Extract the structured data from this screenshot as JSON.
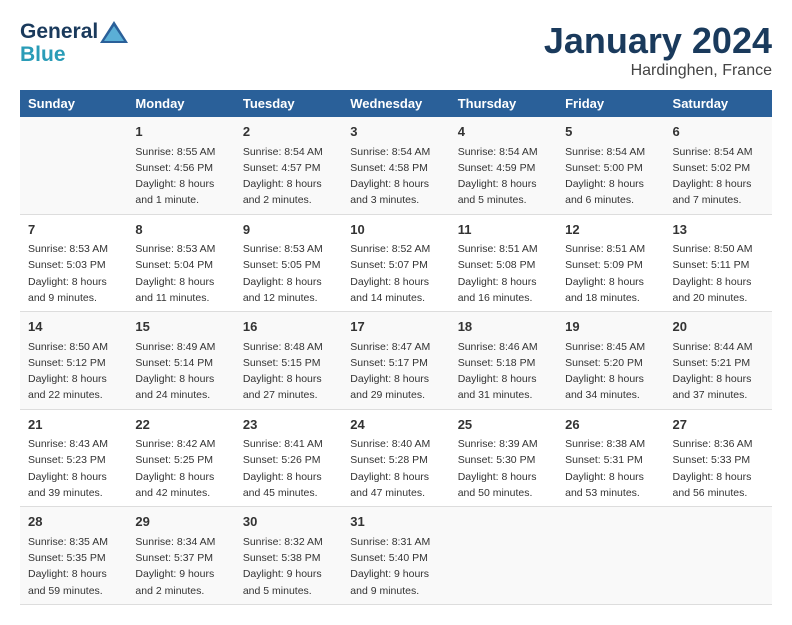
{
  "header": {
    "logo": {
      "line1": "General",
      "line2": "Blue"
    },
    "month": "January 2024",
    "location": "Hardinghen, France"
  },
  "columns": [
    "Sunday",
    "Monday",
    "Tuesday",
    "Wednesday",
    "Thursday",
    "Friday",
    "Saturday"
  ],
  "weeks": [
    [
      {
        "day": "",
        "sunrise": "",
        "sunset": "",
        "daylight": ""
      },
      {
        "day": "1",
        "sunrise": "Sunrise: 8:55 AM",
        "sunset": "Sunset: 4:56 PM",
        "daylight": "Daylight: 8 hours and 1 minute."
      },
      {
        "day": "2",
        "sunrise": "Sunrise: 8:54 AM",
        "sunset": "Sunset: 4:57 PM",
        "daylight": "Daylight: 8 hours and 2 minutes."
      },
      {
        "day": "3",
        "sunrise": "Sunrise: 8:54 AM",
        "sunset": "Sunset: 4:58 PM",
        "daylight": "Daylight: 8 hours and 3 minutes."
      },
      {
        "day": "4",
        "sunrise": "Sunrise: 8:54 AM",
        "sunset": "Sunset: 4:59 PM",
        "daylight": "Daylight: 8 hours and 5 minutes."
      },
      {
        "day": "5",
        "sunrise": "Sunrise: 8:54 AM",
        "sunset": "Sunset: 5:00 PM",
        "daylight": "Daylight: 8 hours and 6 minutes."
      },
      {
        "day": "6",
        "sunrise": "Sunrise: 8:54 AM",
        "sunset": "Sunset: 5:02 PM",
        "daylight": "Daylight: 8 hours and 7 minutes."
      }
    ],
    [
      {
        "day": "7",
        "sunrise": "Sunrise: 8:53 AM",
        "sunset": "Sunset: 5:03 PM",
        "daylight": "Daylight: 8 hours and 9 minutes."
      },
      {
        "day": "8",
        "sunrise": "Sunrise: 8:53 AM",
        "sunset": "Sunset: 5:04 PM",
        "daylight": "Daylight: 8 hours and 11 minutes."
      },
      {
        "day": "9",
        "sunrise": "Sunrise: 8:53 AM",
        "sunset": "Sunset: 5:05 PM",
        "daylight": "Daylight: 8 hours and 12 minutes."
      },
      {
        "day": "10",
        "sunrise": "Sunrise: 8:52 AM",
        "sunset": "Sunset: 5:07 PM",
        "daylight": "Daylight: 8 hours and 14 minutes."
      },
      {
        "day": "11",
        "sunrise": "Sunrise: 8:51 AM",
        "sunset": "Sunset: 5:08 PM",
        "daylight": "Daylight: 8 hours and 16 minutes."
      },
      {
        "day": "12",
        "sunrise": "Sunrise: 8:51 AM",
        "sunset": "Sunset: 5:09 PM",
        "daylight": "Daylight: 8 hours and 18 minutes."
      },
      {
        "day": "13",
        "sunrise": "Sunrise: 8:50 AM",
        "sunset": "Sunset: 5:11 PM",
        "daylight": "Daylight: 8 hours and 20 minutes."
      }
    ],
    [
      {
        "day": "14",
        "sunrise": "Sunrise: 8:50 AM",
        "sunset": "Sunset: 5:12 PM",
        "daylight": "Daylight: 8 hours and 22 minutes."
      },
      {
        "day": "15",
        "sunrise": "Sunrise: 8:49 AM",
        "sunset": "Sunset: 5:14 PM",
        "daylight": "Daylight: 8 hours and 24 minutes."
      },
      {
        "day": "16",
        "sunrise": "Sunrise: 8:48 AM",
        "sunset": "Sunset: 5:15 PM",
        "daylight": "Daylight: 8 hours and 27 minutes."
      },
      {
        "day": "17",
        "sunrise": "Sunrise: 8:47 AM",
        "sunset": "Sunset: 5:17 PM",
        "daylight": "Daylight: 8 hours and 29 minutes."
      },
      {
        "day": "18",
        "sunrise": "Sunrise: 8:46 AM",
        "sunset": "Sunset: 5:18 PM",
        "daylight": "Daylight: 8 hours and 31 minutes."
      },
      {
        "day": "19",
        "sunrise": "Sunrise: 8:45 AM",
        "sunset": "Sunset: 5:20 PM",
        "daylight": "Daylight: 8 hours and 34 minutes."
      },
      {
        "day": "20",
        "sunrise": "Sunrise: 8:44 AM",
        "sunset": "Sunset: 5:21 PM",
        "daylight": "Daylight: 8 hours and 37 minutes."
      }
    ],
    [
      {
        "day": "21",
        "sunrise": "Sunrise: 8:43 AM",
        "sunset": "Sunset: 5:23 PM",
        "daylight": "Daylight: 8 hours and 39 minutes."
      },
      {
        "day": "22",
        "sunrise": "Sunrise: 8:42 AM",
        "sunset": "Sunset: 5:25 PM",
        "daylight": "Daylight: 8 hours and 42 minutes."
      },
      {
        "day": "23",
        "sunrise": "Sunrise: 8:41 AM",
        "sunset": "Sunset: 5:26 PM",
        "daylight": "Daylight: 8 hours and 45 minutes."
      },
      {
        "day": "24",
        "sunrise": "Sunrise: 8:40 AM",
        "sunset": "Sunset: 5:28 PM",
        "daylight": "Daylight: 8 hours and 47 minutes."
      },
      {
        "day": "25",
        "sunrise": "Sunrise: 8:39 AM",
        "sunset": "Sunset: 5:30 PM",
        "daylight": "Daylight: 8 hours and 50 minutes."
      },
      {
        "day": "26",
        "sunrise": "Sunrise: 8:38 AM",
        "sunset": "Sunset: 5:31 PM",
        "daylight": "Daylight: 8 hours and 53 minutes."
      },
      {
        "day": "27",
        "sunrise": "Sunrise: 8:36 AM",
        "sunset": "Sunset: 5:33 PM",
        "daylight": "Daylight: 8 hours and 56 minutes."
      }
    ],
    [
      {
        "day": "28",
        "sunrise": "Sunrise: 8:35 AM",
        "sunset": "Sunset: 5:35 PM",
        "daylight": "Daylight: 8 hours and 59 minutes."
      },
      {
        "day": "29",
        "sunrise": "Sunrise: 8:34 AM",
        "sunset": "Sunset: 5:37 PM",
        "daylight": "Daylight: 9 hours and 2 minutes."
      },
      {
        "day": "30",
        "sunrise": "Sunrise: 8:32 AM",
        "sunset": "Sunset: 5:38 PM",
        "daylight": "Daylight: 9 hours and 5 minutes."
      },
      {
        "day": "31",
        "sunrise": "Sunrise: 8:31 AM",
        "sunset": "Sunset: 5:40 PM",
        "daylight": "Daylight: 9 hours and 9 minutes."
      },
      {
        "day": "",
        "sunrise": "",
        "sunset": "",
        "daylight": ""
      },
      {
        "day": "",
        "sunrise": "",
        "sunset": "",
        "daylight": ""
      },
      {
        "day": "",
        "sunrise": "",
        "sunset": "",
        "daylight": ""
      }
    ]
  ]
}
